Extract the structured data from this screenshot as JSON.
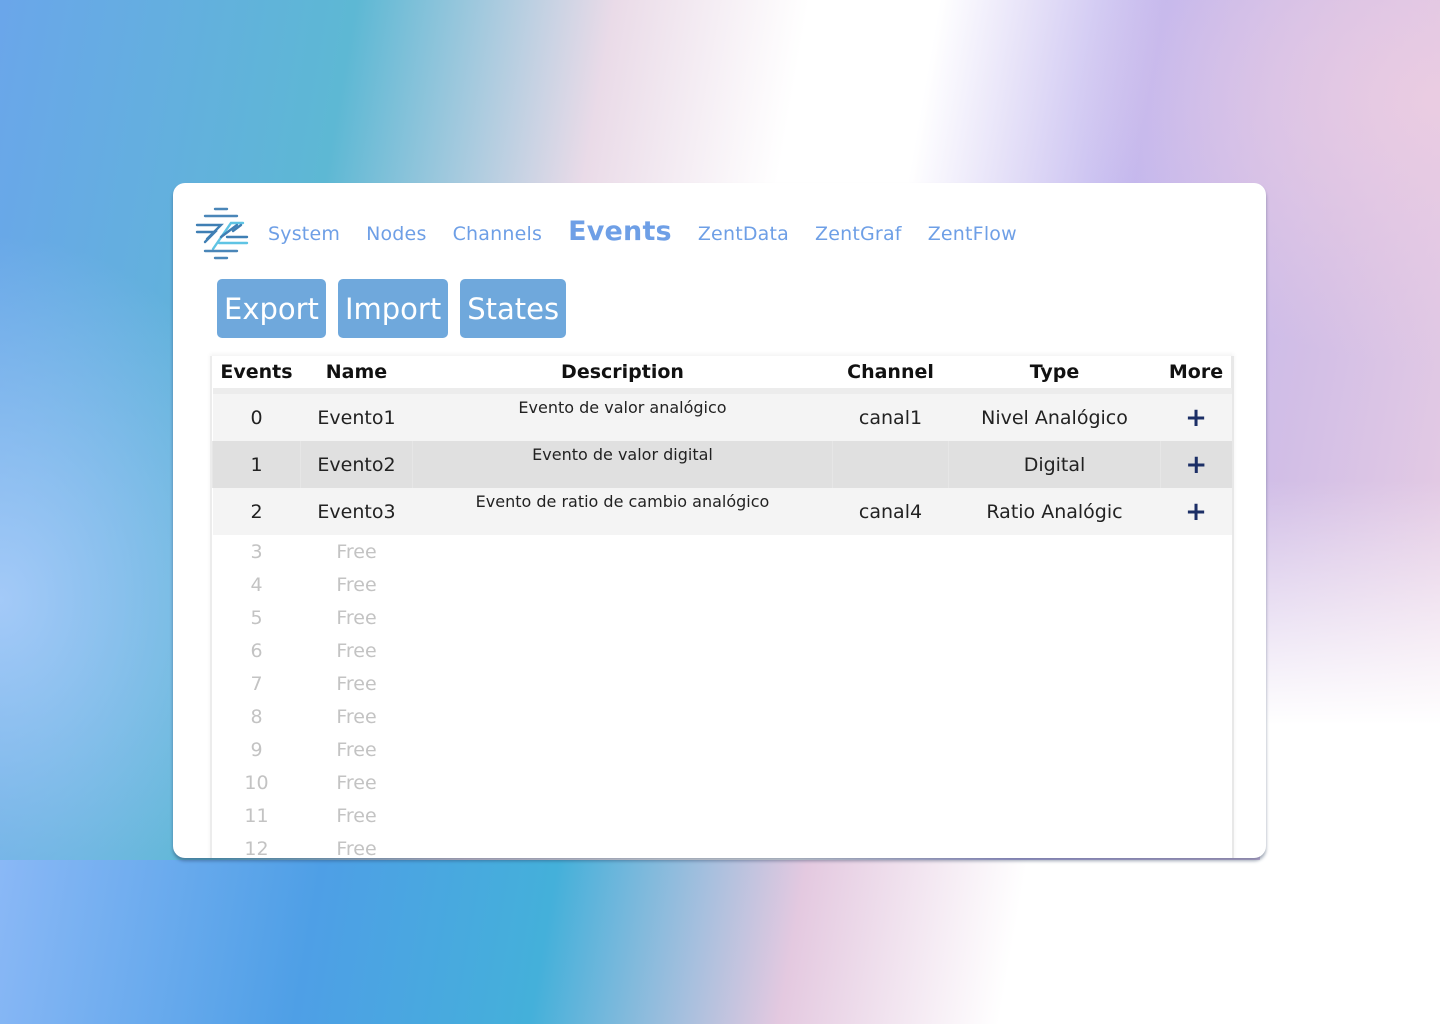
{
  "nav": {
    "logo": "zent-logo-icon",
    "items": [
      {
        "label": "System",
        "active": false
      },
      {
        "label": "Nodes",
        "active": false
      },
      {
        "label": "Channels",
        "active": false
      },
      {
        "label": "Events",
        "active": true
      },
      {
        "label": "ZentData",
        "active": false
      },
      {
        "label": "ZentGraf",
        "active": false
      },
      {
        "label": "ZentFlow",
        "active": false
      }
    ]
  },
  "actions": {
    "export_label": "Export",
    "import_label": "Import",
    "states_label": "States"
  },
  "colors": {
    "accent": "#6e9fe6",
    "button": "#6fa8dc",
    "plus_icon": "#1c2f66",
    "row_light": "#f4f4f4",
    "row_dark": "#e0e0e0",
    "free_text": "#c3c3c3"
  },
  "table": {
    "headers": [
      "Events",
      "Name",
      "Description",
      "Channel",
      "Type",
      "More"
    ],
    "rows": [
      {
        "index": "0",
        "name": "Evento1",
        "description": "Evento de valor analógico",
        "channel": "canal1",
        "type": "Nivel Analógico",
        "more": "+"
      },
      {
        "index": "1",
        "name": "Evento2",
        "description": "Evento de valor digital",
        "channel": "",
        "type": "Digital",
        "more": "+"
      },
      {
        "index": "2",
        "name": "Evento3",
        "description": "Evento de ratio de cambio analógico",
        "channel": "canal4",
        "type": "Ratio Analógic",
        "more": "+"
      }
    ],
    "free_rows": [
      {
        "index": "3",
        "name": "Free"
      },
      {
        "index": "4",
        "name": "Free"
      },
      {
        "index": "5",
        "name": "Free"
      },
      {
        "index": "6",
        "name": "Free"
      },
      {
        "index": "7",
        "name": "Free"
      },
      {
        "index": "8",
        "name": "Free"
      },
      {
        "index": "9",
        "name": "Free"
      },
      {
        "index": "10",
        "name": "Free"
      },
      {
        "index": "11",
        "name": "Free"
      },
      {
        "index": "12",
        "name": "Free"
      }
    ]
  }
}
